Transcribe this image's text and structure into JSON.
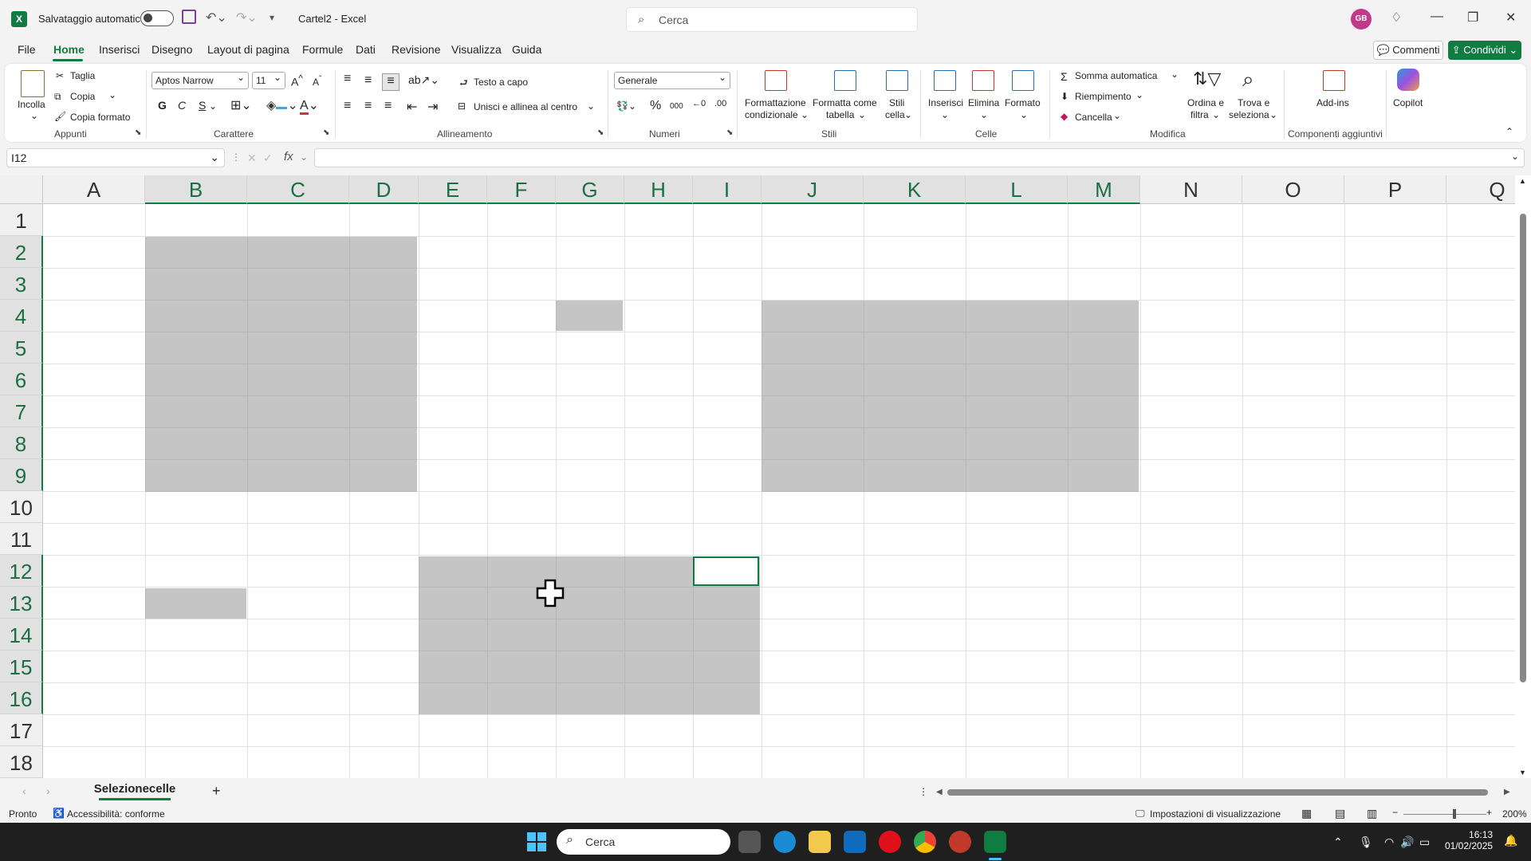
{
  "title": {
    "autosave_label": "Salvataggio automatico",
    "doc_title": "Cartel2  -  Excel",
    "search_placeholder": "Cerca",
    "avatar_initials": "GB"
  },
  "menu": {
    "tabs": [
      "File",
      "Home",
      "Inserisci",
      "Disegno",
      "Layout di pagina",
      "Formule",
      "Dati",
      "Revisione",
      "Visualizza",
      "Guida"
    ],
    "active": "Home",
    "comments_label": "Commenti",
    "share_label": "Condividi"
  },
  "ribbon": {
    "clipboard": {
      "paste": "Incolla",
      "cut": "Taglia",
      "copy": "Copia",
      "format_painter": "Copia formato",
      "group": "Appunti"
    },
    "font": {
      "name": "Aptos Narrow",
      "size": "11",
      "bold": "G",
      "italic": "C",
      "underline": "S",
      "group": "Carattere"
    },
    "alignment": {
      "wrap": "Testo a capo",
      "merge": "Unisci e allinea al centro",
      "group": "Allineamento"
    },
    "number": {
      "format": "Generale",
      "group": "Numeri"
    },
    "styles": {
      "conditional_1": "Formattazione",
      "conditional_2": "condizionale",
      "table_1": "Formatta come",
      "table_2": "tabella",
      "cell_1": "Stili",
      "cell_2": "cella",
      "group": "Stili"
    },
    "cells": {
      "insert": "Inserisci",
      "delete": "Elimina",
      "format": "Formato",
      "group": "Celle"
    },
    "editing": {
      "autosum": "Somma automatica",
      "fill": "Riempimento",
      "clear": "Cancella",
      "sort_1": "Ordina e",
      "sort_2": "filtra",
      "find_1": "Trova e",
      "find_2": "seleziona",
      "group": "Modifica"
    },
    "addins": {
      "label": "Add-ins",
      "group": "Componenti aggiuntivi"
    },
    "copilot": {
      "label": "Copilot"
    }
  },
  "formula": {
    "name_box": "I12",
    "fx_label": "fx",
    "content": ""
  },
  "sheet": {
    "columns": [
      "A",
      "B",
      "C",
      "D",
      "E",
      "F",
      "G",
      "H",
      "I",
      "J",
      "K",
      "L",
      "M",
      "N",
      "O",
      "P",
      "Q"
    ],
    "rows": [
      "1",
      "2",
      "3",
      "4",
      "5",
      "6",
      "7",
      "8",
      "9",
      "10",
      "11",
      "12",
      "13",
      "14",
      "15",
      "16",
      "17",
      "18"
    ],
    "selected_columns": [
      "B",
      "C",
      "D",
      "E",
      "F",
      "G",
      "H",
      "I",
      "J",
      "K",
      "L",
      "M"
    ],
    "selected_rows": [
      "2",
      "3",
      "4",
      "5",
      "6",
      "7",
      "8",
      "9",
      "12",
      "13",
      "14",
      "15",
      "16"
    ]
  },
  "tabs": {
    "sheet_name": "Selezionecelle",
    "add": "+"
  },
  "status": {
    "ready": "Pronto",
    "accessibility": "Accessibilità: conforme",
    "display_settings": "Impostazioni di visualizzazione",
    "zoom": "200%"
  },
  "taskbar": {
    "search_placeholder": "Cerca",
    "time": "16:13",
    "date": "01/02/2025"
  },
  "colors": {
    "accent": "#107c41",
    "selection": "#c6c6c6"
  }
}
